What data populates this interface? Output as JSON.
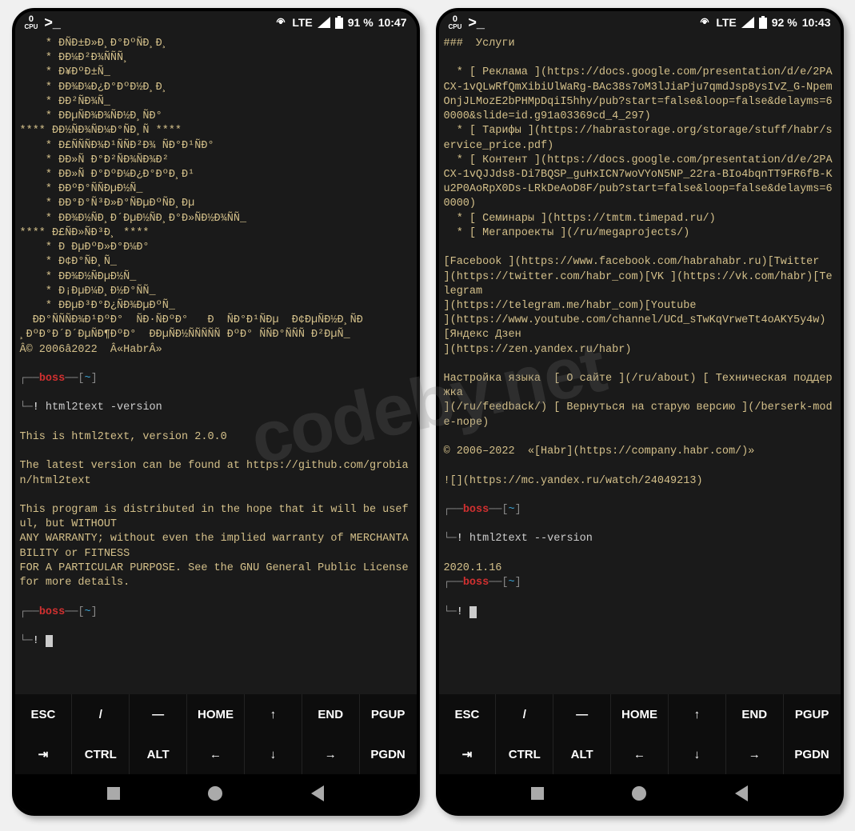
{
  "watermark": "codeby.net",
  "left": {
    "status": {
      "cpu": "0",
      "cpuLabel": "CPU",
      "lte": "LTE",
      "battery": "91 %",
      "time": "10:47"
    },
    "terminal": "    * ÐÑÐ±Ð»Ð¸Ð°ÐºÑÐ¸Ð¸\n    * ÐÐ¼Ð²Ð¾ÑÑÑ¸\n    * Ð¥ÐºÐ±Ñ_\n    * ÐÐ¾Ð¼Ð¿Ð°ÐºÐ½Ð¸Ð¸\n    * ÐÐ²ÑÐ¾Ñ_\n    * ÐÐµÑÐ¾Ð¾ÑÐ½Ð¸ÑÐ°\n**** ÐÐ½ÑÐ¾ÑÐ¼Ð°ÑÐ¸Ñ ****\n    * Ð£ÑÑÑÐ¾Ð¹ÑÑÐ²Ð¾ ÑÐ°Ð¹ÑÐ°\n    * ÐÐ»Ñ Ð°Ð²ÑÐ¾ÑÐ¾Ð²\n    * ÐÐ»Ñ Ð°ÐºÐ¼Ð¿Ð°ÐºÐ¸Ð¹\n    * ÐÐºÐ°ÑÑÐµÐ½Ñ_\n    * ÐÐ°Ð°Ñ³Ð»Ð°ÑÐµÐºÑÐ¸Ðµ\n    * ÐÐ¾Ð½ÑÐ¸Ð´ÐµÐ½ÑÐ¸Ð°Ð»ÑÐ½Ð¾ÑÑ_\n**** Ð£ÑÐ»ÑÐ³Ð¸ ****\n    * Ð ÐµÐºÐ»Ð°Ð¼Ð°\n    * Ð¢Ð°ÑÐ¸Ñ_\n    * ÐÐ¾Ð½ÑÐµÐ½Ñ_\n    * Ð¡ÐµÐ¼Ð¸Ð½Ð°ÑÑ_\n    * ÐÐµÐ³Ð°Ð¿ÑÐ¾ÐµÐºÑ_\n  ÐÐ°ÑÑÑÐ¾Ð¹ÐºÐ°  ÑÐ·ÑÐºÐ°   Ð  ÑÐ°Ð¹ÑÐµ  Ð¢ÐµÑÐ½Ð¸ÑÐ\n¸ÐºÐ°Ð´Ð´ÐµÑÐ¶ÐºÐ°  ÐÐµÑÐ½ÑÑÑÑÑ ÐºÐ° ÑÑÐ°ÑÑÑ Ð²ÐµÑ_\nÂ© 2006â2022  Â«HabrÂ»",
    "prompt1": {
      "user": "boss",
      "path": "~",
      "cmd": "html2text -version"
    },
    "versionout": "This is html2text, version 2.0.0\n\nThe latest version can be found at https://github.com/grobian/html2text\n\nThis program is distributed in the hope that it will be useful, but WITHOUT\nANY WARRANTY; without even the implied warranty of MERCHANTABILITY or FITNESS\nFOR A PARTICULAR PURPOSE. See the GNU General Public License for more details.",
    "prompt2": {
      "user": "boss",
      "path": "~"
    }
  },
  "right": {
    "status": {
      "cpu": "0",
      "cpuLabel": "CPU",
      "lte": "LTE",
      "battery": "92 %",
      "time": "10:43"
    },
    "terminal": "###  Услуги\n\n  * [ Реклама ](https://docs.google.com/presentation/d/e/2PACX-1vQLwRfQmXibiUlWaRg-BAc38s7oM3lJiaPju7qmdJsp8ysIvZ_G-NpemOnjJLMozE2bPHMpDqiI5hhy/pub?start=false&loop=false&delayms=60000&slide=id.g91a03369cd_4_297)\n  * [ Тарифы ](https://habrastorage.org/storage/stuff/habr/service_price.pdf)\n  * [ Контент ](https://docs.google.com/presentation/d/e/2PACX-1vQJJds8-Di7BQSP_guHxICN7woVYoN5NP_22ra-BIo4bqnTT9FR6fB-Ku2P0AoRpX0Ds-LRkDeAoD8F/pub?start=false&loop=false&delayms=60000)\n  * [ Семинары ](https://tmtm.timepad.ru/)\n  * [ Мегапроекты ](/ru/megaprojects/)\n\n[Facebook ](https://www.facebook.com/habrahabr.ru)[Twitter\n](https://twitter.com/habr_com)[VK ](https://vk.com/habr)[Telegram\n](https://telegram.me/habr_com)[Youtube\n](https://www.youtube.com/channel/UCd_sTwKqVrweTt4oAKY5y4w)[Яндекс Дзен\n](https://zen.yandex.ru/habr)\n\nНастройка языка  [ О сайте ](/ru/about) [ Техническая поддержка\n](/ru/feedback/) [ Вернуться на старую версию ](/berserk-mode-nope)\n\n© 2006–2022  «[Habr](https://company.habr.com/)»\n\n![](https://mc.yandex.ru/watch/24049213)",
    "prompt1": {
      "user": "boss",
      "path": "~",
      "cmd": "html2text --version"
    },
    "versionout": "2020.1.16",
    "prompt2": {
      "user": "boss",
      "path": "~"
    }
  },
  "keys": {
    "row1": [
      "ESC",
      "/",
      "—",
      "HOME",
      "↑",
      "END",
      "PGUP"
    ],
    "row2": [
      "⇥",
      "CTRL",
      "ALT",
      "←",
      "↓",
      "→",
      "PGDN"
    ]
  }
}
